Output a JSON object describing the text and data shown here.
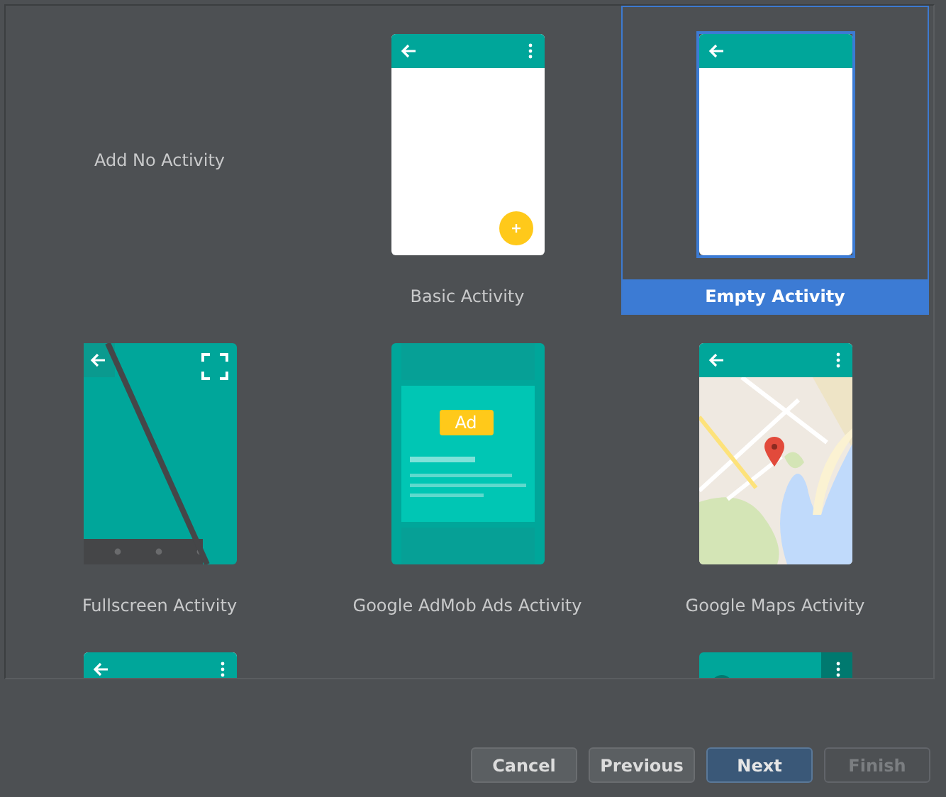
{
  "templates": [
    {
      "kind": "none",
      "label": "Add No Activity",
      "selected": false
    },
    {
      "kind": "basic",
      "label": "Basic Activity",
      "selected": false
    },
    {
      "kind": "empty",
      "label": "Empty Activity",
      "selected": true
    },
    {
      "kind": "fullscreen",
      "label": "Fullscreen Activity",
      "selected": false
    },
    {
      "kind": "admob",
      "label": "Google AdMob Ads Activity",
      "ad_text": "Ad",
      "selected": false
    },
    {
      "kind": "maps",
      "label": "Google Maps Activity",
      "selected": false
    },
    {
      "kind": "toolbar",
      "selected": false
    },
    {
      "kind": "blank"
    },
    {
      "kind": "drawer",
      "selected": false
    }
  ],
  "buttons": [
    {
      "label": "Cancel",
      "primary": false,
      "disabled": false
    },
    {
      "label": "Previous",
      "primary": false,
      "disabled": false
    },
    {
      "label": "Next",
      "primary": true,
      "disabled": false
    },
    {
      "label": "Finish",
      "primary": false,
      "disabled": true
    }
  ]
}
